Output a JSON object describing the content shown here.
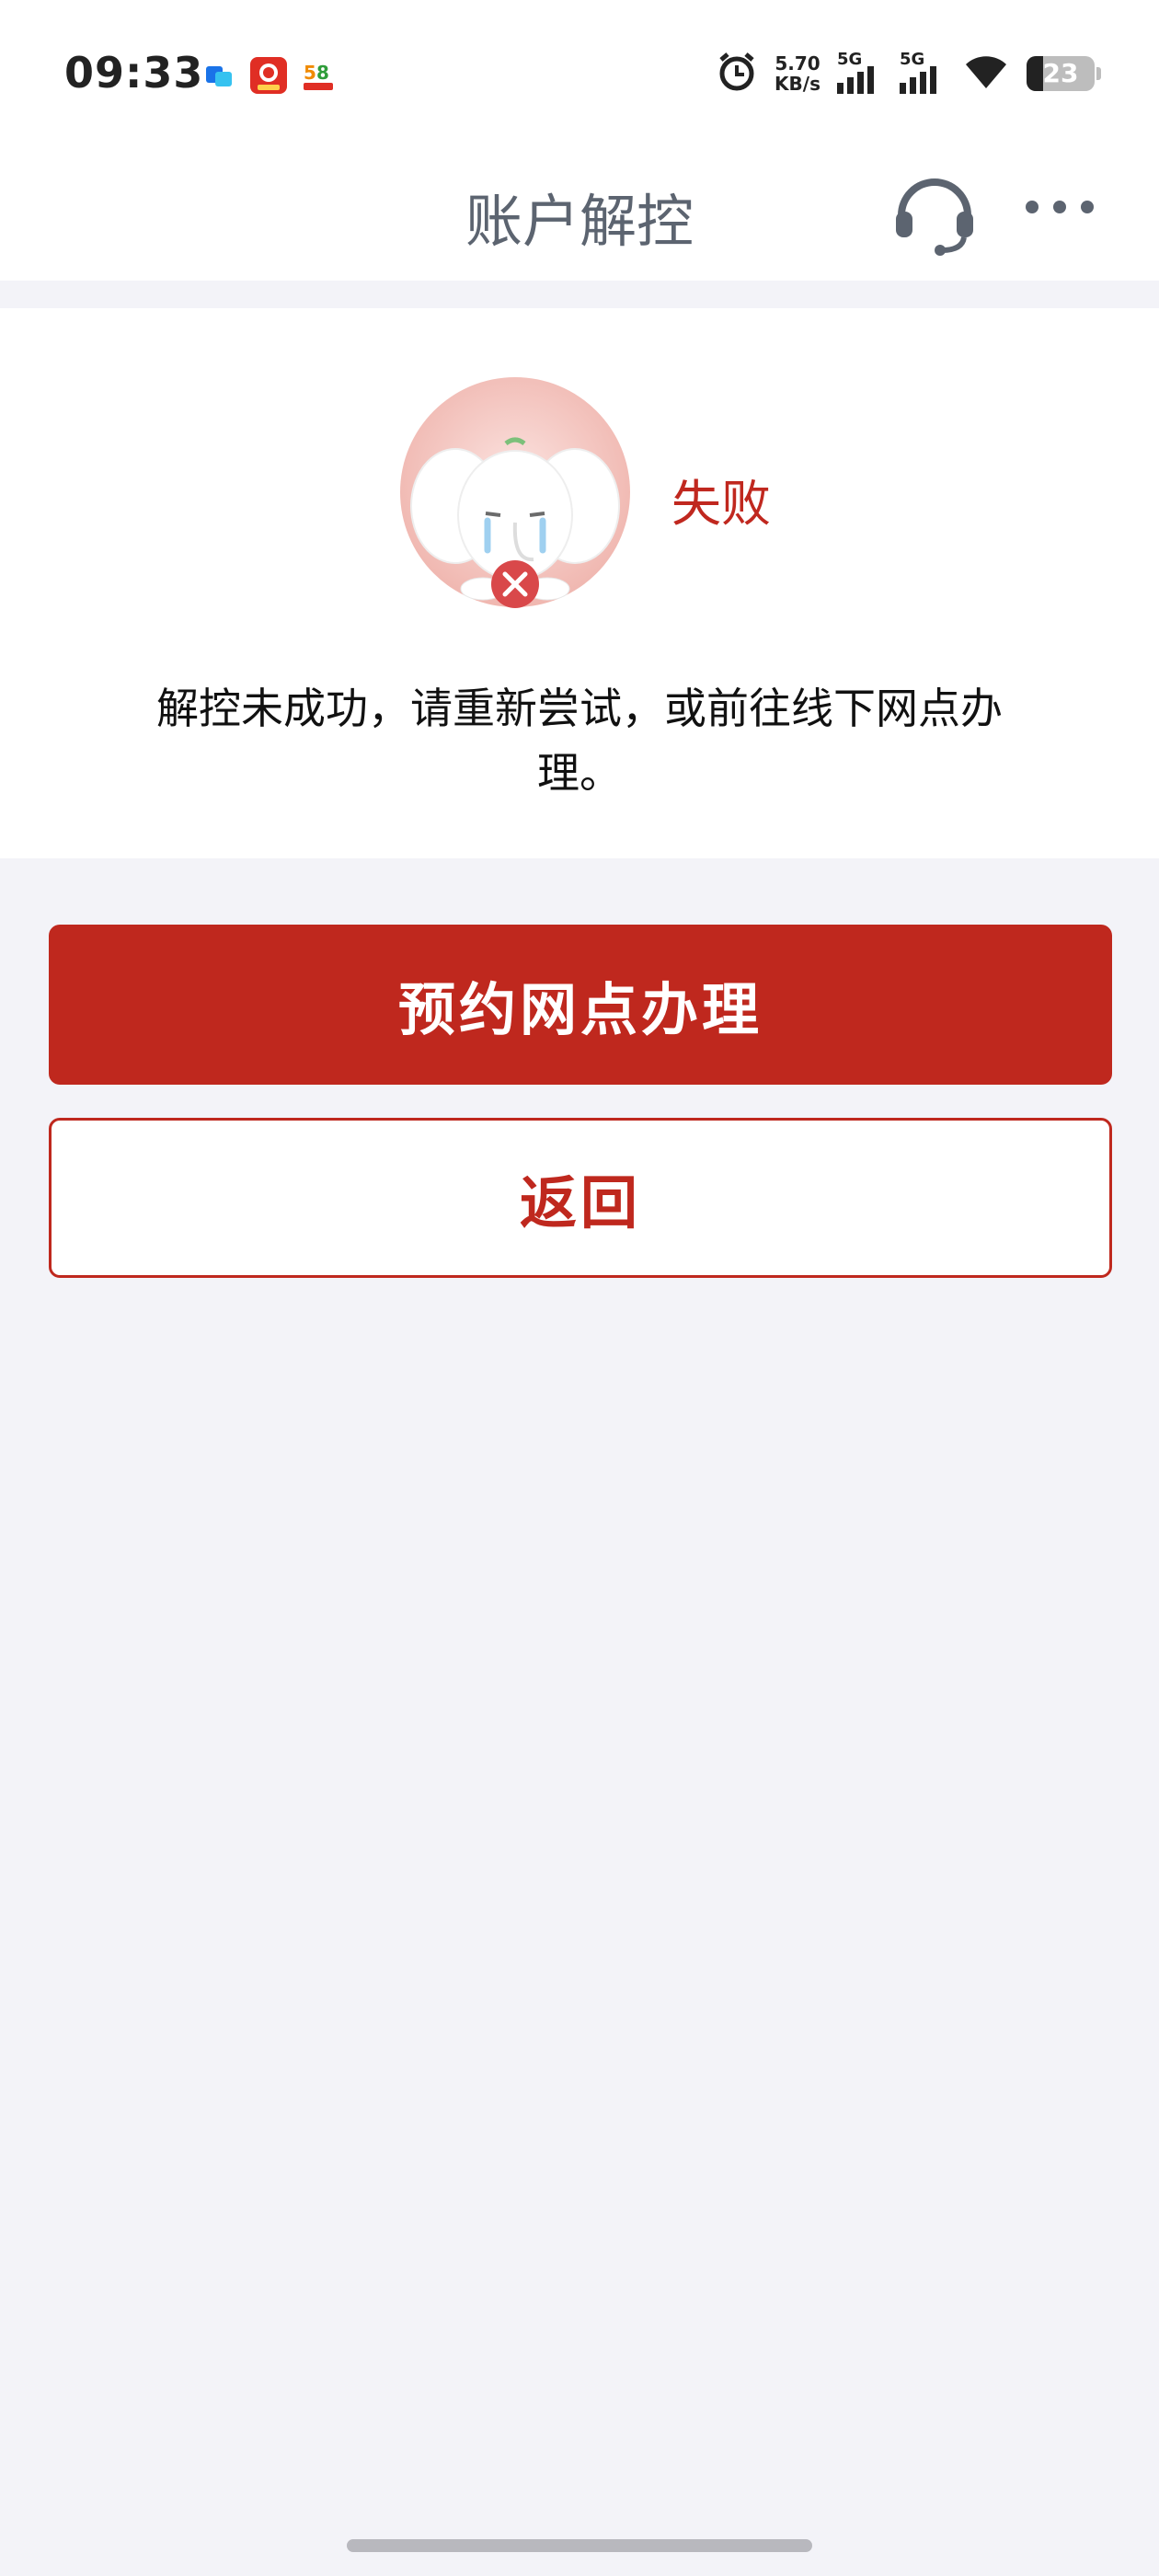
{
  "status_bar": {
    "time": "09:33",
    "net_speed_value": "5.70",
    "net_speed_unit": "KB/s",
    "signal_1_label": "5G",
    "signal_2_label": "5G",
    "battery_level": "23",
    "notification_icons": [
      "tencent-app-icon",
      "pinduoduo-app-icon",
      "58-app-icon"
    ]
  },
  "nav": {
    "title": "账户解控",
    "icons": [
      "headset-icon",
      "more-icon"
    ]
  },
  "result": {
    "status": "失败",
    "message": "解控未成功，请重新尝试，或前往线下网点办理。",
    "status_color": "#c0281f"
  },
  "actions": {
    "primary_label": "预约网点办理",
    "secondary_label": "返回",
    "accent_color": "#bf281e"
  }
}
